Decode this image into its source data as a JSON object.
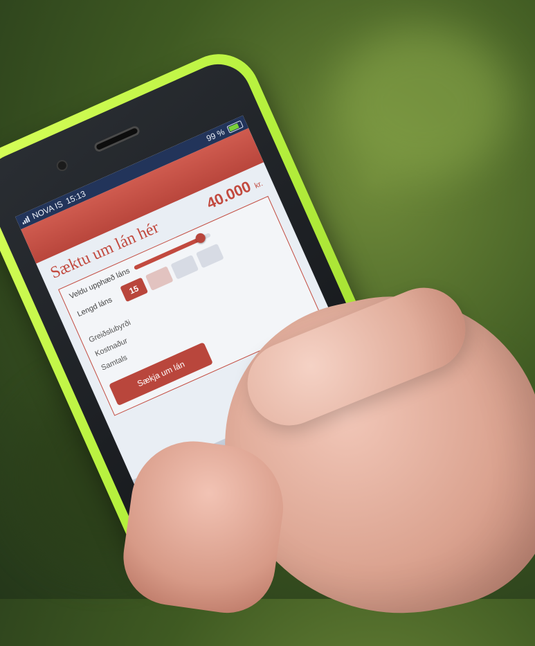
{
  "status_bar": {
    "carrier": "NOVA IS",
    "time": "15:13",
    "battery": "99 %"
  },
  "loan_form": {
    "title": "Sæktu um lán hér",
    "amount": "40.000",
    "currency": "kr.",
    "amount_label": "Veldu upphæð láns",
    "length_label": "Lengd láns",
    "selected_day_chip": "15",
    "fee_label": "Greiðslubyrði",
    "rows": [
      "Kostnaður",
      "Samtals"
    ],
    "cta_label": "Sækja um lán"
  },
  "colors": {
    "accent": "#b9463c",
    "bumper": "#b5f03d"
  }
}
